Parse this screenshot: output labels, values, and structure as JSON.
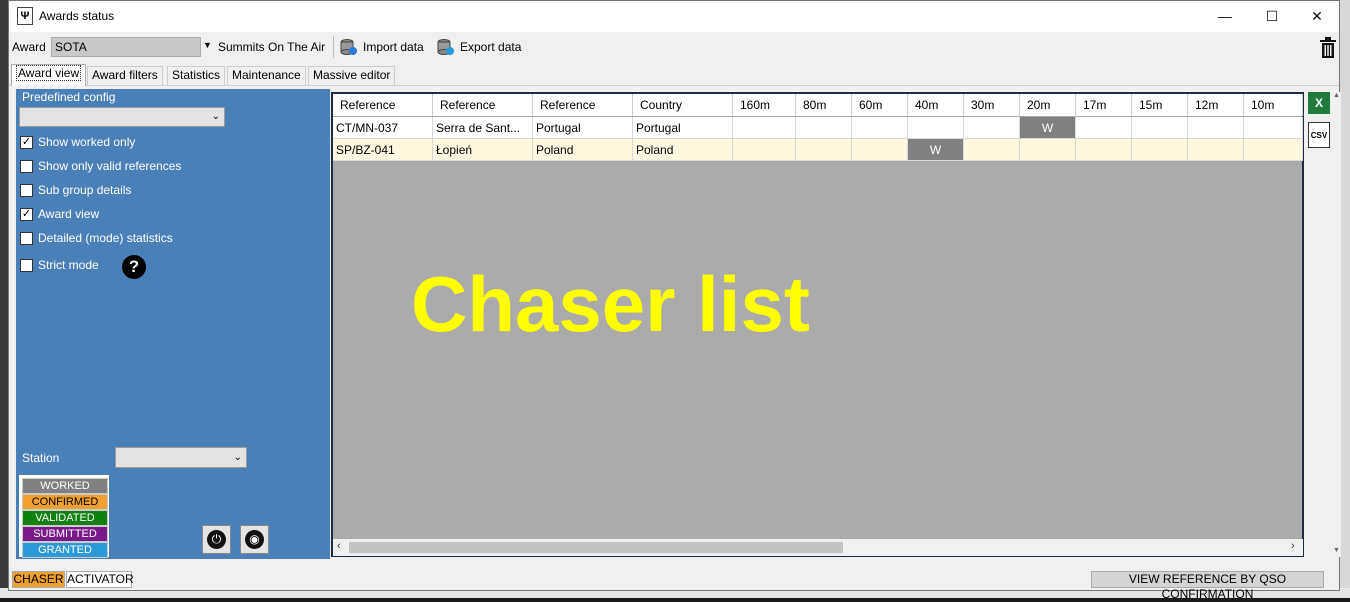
{
  "window": {
    "title": "Awards status"
  },
  "toolbar": {
    "award_label": "Award",
    "award_value": "SOTA",
    "award_description": "Summits On The Air",
    "import_label": "Import data",
    "export_label": "Export data"
  },
  "tabs": [
    {
      "label": "Award view",
      "active": true
    },
    {
      "label": "Award filters"
    },
    {
      "label": "Statistics"
    },
    {
      "label": "Maintenance"
    },
    {
      "label": "Massive editor"
    }
  ],
  "left_panel": {
    "predefined_label": "Predefined config",
    "options": [
      {
        "label": "Show worked only",
        "checked": true
      },
      {
        "label": "Show only valid references",
        "checked": false
      },
      {
        "label": "Sub group details",
        "checked": false
      },
      {
        "label": "Award view",
        "checked": true
      },
      {
        "label": "Detailed (mode) statistics",
        "checked": false
      },
      {
        "label": "Strict mode",
        "checked": false
      }
    ],
    "station_label": "Station",
    "legend": [
      {
        "label": "WORKED",
        "color": "#808080"
      },
      {
        "label": "CONFIRMED",
        "color": "#f0a030"
      },
      {
        "label": "VALIDATED",
        "color": "#108010"
      },
      {
        "label": "SUBMITTED",
        "color": "#7a1a8a"
      },
      {
        "label": "GRANTED",
        "color": "#2a9ad8"
      }
    ]
  },
  "grid": {
    "columns": [
      "Reference",
      "Reference",
      "Reference",
      "Country",
      "160m",
      "80m",
      "60m",
      "40m",
      "30m",
      "20m",
      "17m",
      "15m",
      "12m",
      "10m"
    ],
    "rows": [
      {
        "cells": [
          "CT/MN-037",
          "Serra de Sant...",
          "Portugal",
          "Portugal",
          "",
          "",
          "",
          "",
          "",
          "W",
          "",
          "",
          "",
          ""
        ],
        "highlight": false
      },
      {
        "cells": [
          "SP/BZ-041",
          "Łopień",
          "Poland",
          "Poland",
          "",
          "",
          "",
          "W",
          "",
          "",
          "",
          "",
          "",
          ""
        ],
        "highlight": true
      }
    ]
  },
  "overlay_text": "Chaser list",
  "bottom": {
    "chaser": "CHASER",
    "activator": "ACTIVATOR",
    "view_reference": "VIEW REFERENCE BY QSO CONFIRMATION"
  }
}
